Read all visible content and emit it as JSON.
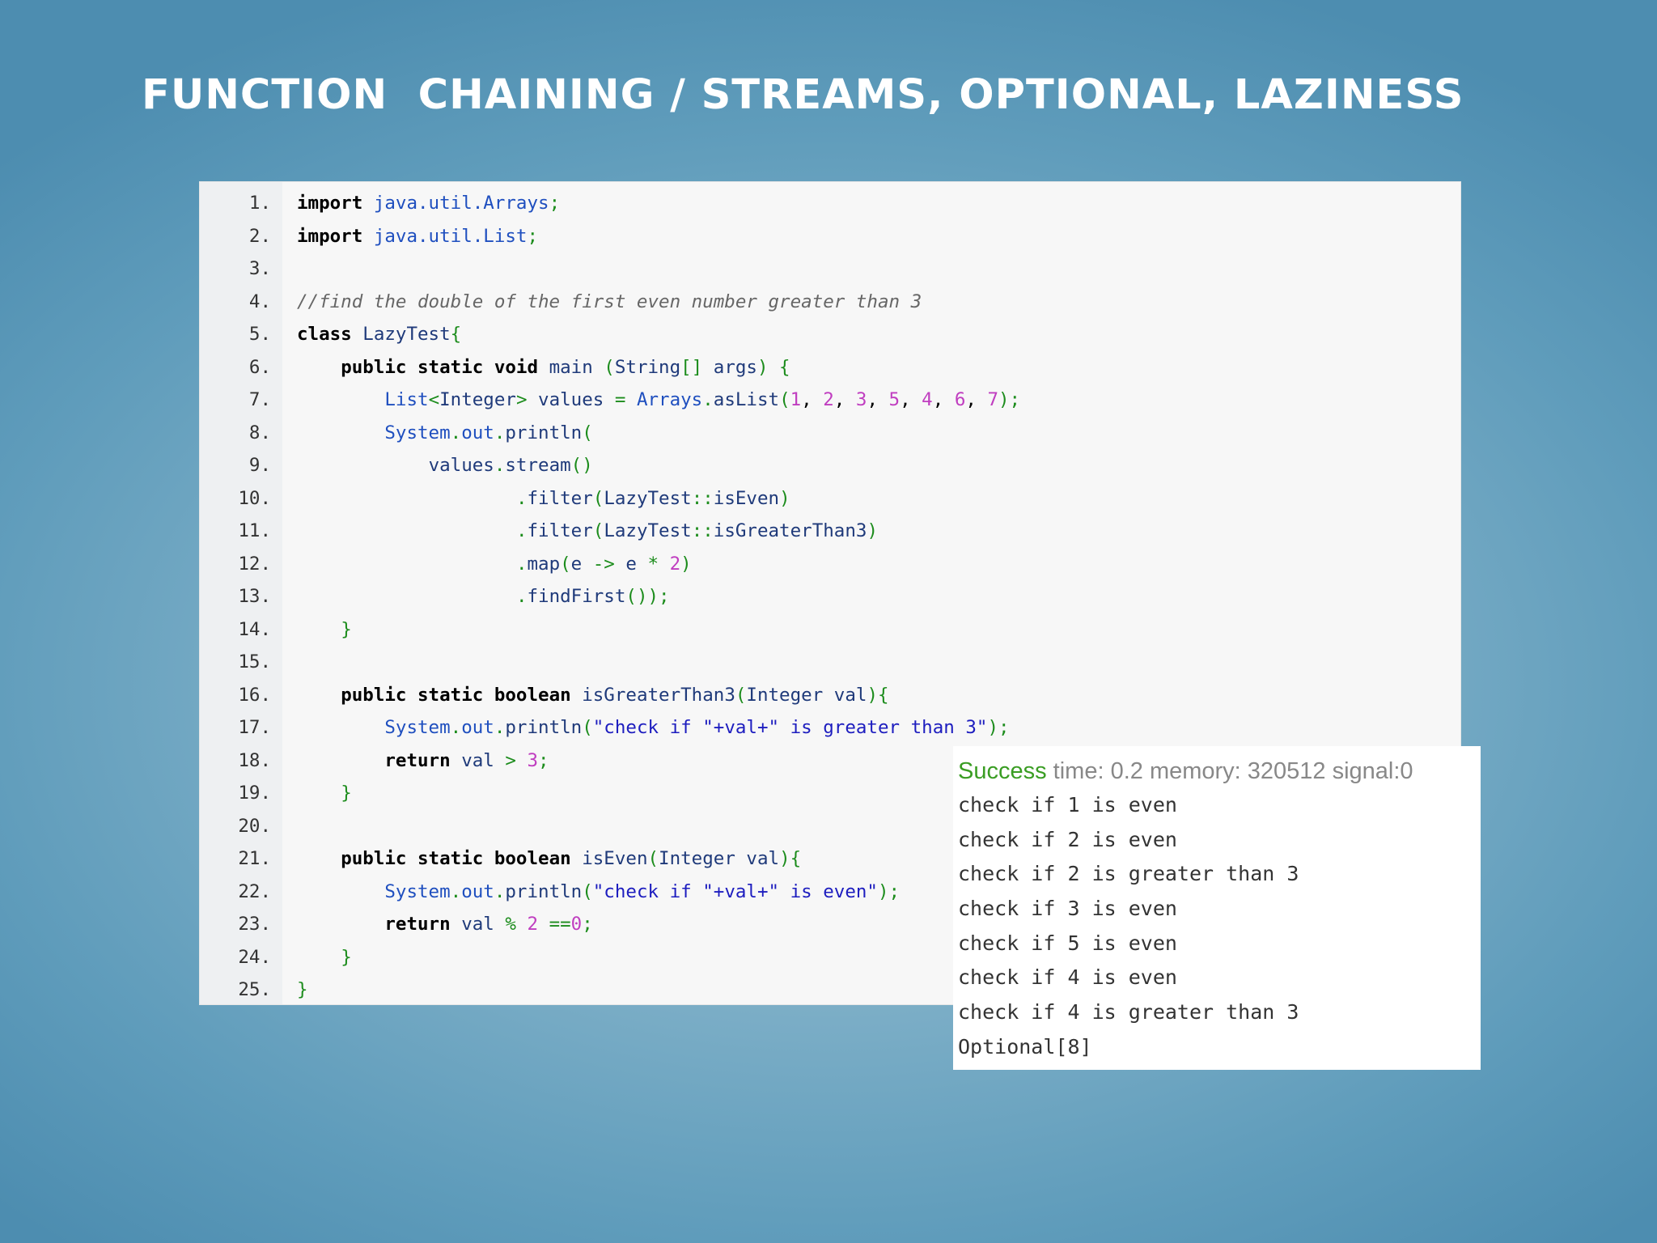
{
  "slide": {
    "title": "FUNCTION  CHAINING / STREAMS, OPTIONAL, LAZINESS"
  },
  "code": {
    "lines": [
      {
        "n": "1.",
        "tokens": [
          {
            "t": "import",
            "k": "kw"
          },
          {
            "t": " ",
            "k": "plain"
          },
          {
            "t": "java.util.Arrays",
            "k": "pkg"
          },
          {
            "t": ";",
            "k": "punc"
          }
        ]
      },
      {
        "n": "2.",
        "tokens": [
          {
            "t": "import",
            "k": "kw"
          },
          {
            "t": " ",
            "k": "plain"
          },
          {
            "t": "java.util.List",
            "k": "pkg"
          },
          {
            "t": ";",
            "k": "punc"
          }
        ]
      },
      {
        "n": "3.",
        "tokens": []
      },
      {
        "n": "4.",
        "tokens": [
          {
            "t": "//find the double of the first even number greater than 3",
            "k": "cmt"
          }
        ]
      },
      {
        "n": "5.",
        "tokens": [
          {
            "t": "class",
            "k": "kw"
          },
          {
            "t": " ",
            "k": "plain"
          },
          {
            "t": "LazyTest",
            "k": "ident"
          },
          {
            "t": "{",
            "k": "punc"
          }
        ]
      },
      {
        "n": "6.",
        "tokens": [
          {
            "t": "    ",
            "k": "plain"
          },
          {
            "t": "public static void",
            "k": "kw"
          },
          {
            "t": " ",
            "k": "plain"
          },
          {
            "t": "main",
            "k": "ident"
          },
          {
            "t": " (",
            "k": "punc"
          },
          {
            "t": "String",
            "k": "ident"
          },
          {
            "t": "[]",
            "k": "punc"
          },
          {
            "t": " ",
            "k": "plain"
          },
          {
            "t": "args",
            "k": "ident"
          },
          {
            "t": ") {",
            "k": "punc"
          }
        ]
      },
      {
        "n": "7.",
        "tokens": [
          {
            "t": "        ",
            "k": "plain"
          },
          {
            "t": "List",
            "k": "pkg"
          },
          {
            "t": "<",
            "k": "punc"
          },
          {
            "t": "Integer",
            "k": "ident"
          },
          {
            "t": ">",
            "k": "punc"
          },
          {
            "t": " ",
            "k": "plain"
          },
          {
            "t": "values",
            "k": "ident"
          },
          {
            "t": " = ",
            "k": "punc"
          },
          {
            "t": "Arrays",
            "k": "pkg"
          },
          {
            "t": ".",
            "k": "punc"
          },
          {
            "t": "asList",
            "k": "ident"
          },
          {
            "t": "(",
            "k": "punc"
          },
          {
            "t": "1",
            "k": "num"
          },
          {
            "t": ", ",
            "k": "plain"
          },
          {
            "t": "2",
            "k": "num"
          },
          {
            "t": ", ",
            "k": "plain"
          },
          {
            "t": "3",
            "k": "num"
          },
          {
            "t": ", ",
            "k": "plain"
          },
          {
            "t": "5",
            "k": "num"
          },
          {
            "t": ", ",
            "k": "plain"
          },
          {
            "t": "4",
            "k": "num"
          },
          {
            "t": ", ",
            "k": "plain"
          },
          {
            "t": "6",
            "k": "num"
          },
          {
            "t": ", ",
            "k": "plain"
          },
          {
            "t": "7",
            "k": "num"
          },
          {
            "t": ");",
            "k": "punc"
          }
        ]
      },
      {
        "n": "8.",
        "tokens": [
          {
            "t": "        ",
            "k": "plain"
          },
          {
            "t": "System",
            "k": "pkg"
          },
          {
            "t": ".",
            "k": "punc"
          },
          {
            "t": "out",
            "k": "pkg"
          },
          {
            "t": ".",
            "k": "punc"
          },
          {
            "t": "println",
            "k": "ident"
          },
          {
            "t": "(",
            "k": "punc"
          }
        ]
      },
      {
        "n": "9.",
        "tokens": [
          {
            "t": "            ",
            "k": "plain"
          },
          {
            "t": "values",
            "k": "ident"
          },
          {
            "t": ".",
            "k": "punc"
          },
          {
            "t": "stream",
            "k": "ident"
          },
          {
            "t": "()",
            "k": "punc"
          }
        ]
      },
      {
        "n": "10.",
        "tokens": [
          {
            "t": "                    ",
            "k": "plain"
          },
          {
            "t": ".",
            "k": "punc"
          },
          {
            "t": "filter",
            "k": "ident"
          },
          {
            "t": "(",
            "k": "punc"
          },
          {
            "t": "LazyTest",
            "k": "ident"
          },
          {
            "t": "::",
            "k": "punc"
          },
          {
            "t": "isEven",
            "k": "ident"
          },
          {
            "t": ")",
            "k": "punc"
          }
        ]
      },
      {
        "n": "11.",
        "tokens": [
          {
            "t": "                    ",
            "k": "plain"
          },
          {
            "t": ".",
            "k": "punc"
          },
          {
            "t": "filter",
            "k": "ident"
          },
          {
            "t": "(",
            "k": "punc"
          },
          {
            "t": "LazyTest",
            "k": "ident"
          },
          {
            "t": "::",
            "k": "punc"
          },
          {
            "t": "isGreaterThan3",
            "k": "ident"
          },
          {
            "t": ")",
            "k": "punc"
          }
        ]
      },
      {
        "n": "12.",
        "tokens": [
          {
            "t": "                    ",
            "k": "plain"
          },
          {
            "t": ".",
            "k": "punc"
          },
          {
            "t": "map",
            "k": "ident"
          },
          {
            "t": "(",
            "k": "punc"
          },
          {
            "t": "e",
            "k": "ident"
          },
          {
            "t": " -> ",
            "k": "punc"
          },
          {
            "t": "e",
            "k": "ident"
          },
          {
            "t": " * ",
            "k": "punc"
          },
          {
            "t": "2",
            "k": "num"
          },
          {
            "t": ")",
            "k": "punc"
          }
        ]
      },
      {
        "n": "13.",
        "tokens": [
          {
            "t": "                    ",
            "k": "plain"
          },
          {
            "t": ".",
            "k": "punc"
          },
          {
            "t": "findFirst",
            "k": "ident"
          },
          {
            "t": "());",
            "k": "punc"
          }
        ]
      },
      {
        "n": "14.",
        "tokens": [
          {
            "t": "    ",
            "k": "plain"
          },
          {
            "t": "}",
            "k": "punc"
          }
        ]
      },
      {
        "n": "15.",
        "tokens": []
      },
      {
        "n": "16.",
        "tokens": [
          {
            "t": "    ",
            "k": "plain"
          },
          {
            "t": "public static boolean",
            "k": "kw"
          },
          {
            "t": " ",
            "k": "plain"
          },
          {
            "t": "isGreaterThan3",
            "k": "ident"
          },
          {
            "t": "(",
            "k": "punc"
          },
          {
            "t": "Integer",
            "k": "ident"
          },
          {
            "t": " ",
            "k": "plain"
          },
          {
            "t": "val",
            "k": "ident"
          },
          {
            "t": "){",
            "k": "punc"
          }
        ]
      },
      {
        "n": "17.",
        "tokens": [
          {
            "t": "        ",
            "k": "plain"
          },
          {
            "t": "System",
            "k": "pkg"
          },
          {
            "t": ".",
            "k": "punc"
          },
          {
            "t": "out",
            "k": "pkg"
          },
          {
            "t": ".",
            "k": "punc"
          },
          {
            "t": "println",
            "k": "ident"
          },
          {
            "t": "(",
            "k": "punc"
          },
          {
            "t": "\"check if \"+val+\" is greater than 3\"",
            "k": "str"
          },
          {
            "t": ");",
            "k": "punc"
          }
        ]
      },
      {
        "n": "18.",
        "tokens": [
          {
            "t": "        ",
            "k": "plain"
          },
          {
            "t": "return",
            "k": "kw"
          },
          {
            "t": " ",
            "k": "plain"
          },
          {
            "t": "val",
            "k": "ident"
          },
          {
            "t": " > ",
            "k": "punc"
          },
          {
            "t": "3",
            "k": "num"
          },
          {
            "t": ";",
            "k": "punc"
          }
        ]
      },
      {
        "n": "19.",
        "tokens": [
          {
            "t": "    ",
            "k": "plain"
          },
          {
            "t": "}",
            "k": "punc"
          }
        ]
      },
      {
        "n": "20.",
        "tokens": []
      },
      {
        "n": "21.",
        "tokens": [
          {
            "t": "    ",
            "k": "plain"
          },
          {
            "t": "public static boolean",
            "k": "kw"
          },
          {
            "t": " ",
            "k": "plain"
          },
          {
            "t": "isEven",
            "k": "ident"
          },
          {
            "t": "(",
            "k": "punc"
          },
          {
            "t": "Integer",
            "k": "ident"
          },
          {
            "t": " ",
            "k": "plain"
          },
          {
            "t": "val",
            "k": "ident"
          },
          {
            "t": "){",
            "k": "punc"
          }
        ]
      },
      {
        "n": "22.",
        "tokens": [
          {
            "t": "        ",
            "k": "plain"
          },
          {
            "t": "System",
            "k": "pkg"
          },
          {
            "t": ".",
            "k": "punc"
          },
          {
            "t": "out",
            "k": "pkg"
          },
          {
            "t": ".",
            "k": "punc"
          },
          {
            "t": "println",
            "k": "ident"
          },
          {
            "t": "(",
            "k": "punc"
          },
          {
            "t": "\"check if \"+val+\" is even\"",
            "k": "str"
          },
          {
            "t": ");",
            "k": "punc"
          }
        ]
      },
      {
        "n": "23.",
        "tokens": [
          {
            "t": "        ",
            "k": "plain"
          },
          {
            "t": "return",
            "k": "kw"
          },
          {
            "t": " ",
            "k": "plain"
          },
          {
            "t": "val",
            "k": "ident"
          },
          {
            "t": " % ",
            "k": "punc"
          },
          {
            "t": "2",
            "k": "num"
          },
          {
            "t": " ==",
            "k": "punc"
          },
          {
            "t": "0",
            "k": "num"
          },
          {
            "t": ";",
            "k": "punc"
          }
        ]
      },
      {
        "n": "24.",
        "tokens": [
          {
            "t": "    ",
            "k": "plain"
          },
          {
            "t": "}",
            "k": "punc"
          }
        ]
      },
      {
        "n": "25.",
        "tokens": [
          {
            "t": "}",
            "k": "punc"
          }
        ]
      }
    ]
  },
  "output": {
    "status_label": "Success",
    "status_details": " time: 0.2 memory: 320512 signal:0",
    "lines": [
      "check if 1 is even",
      "check if 2 is even",
      "check if 2 is greater than 3",
      "check if 3 is even",
      "check if 5 is even",
      "check if 4 is even",
      "check if 4 is greater than 3",
      "Optional[8]"
    ]
  }
}
